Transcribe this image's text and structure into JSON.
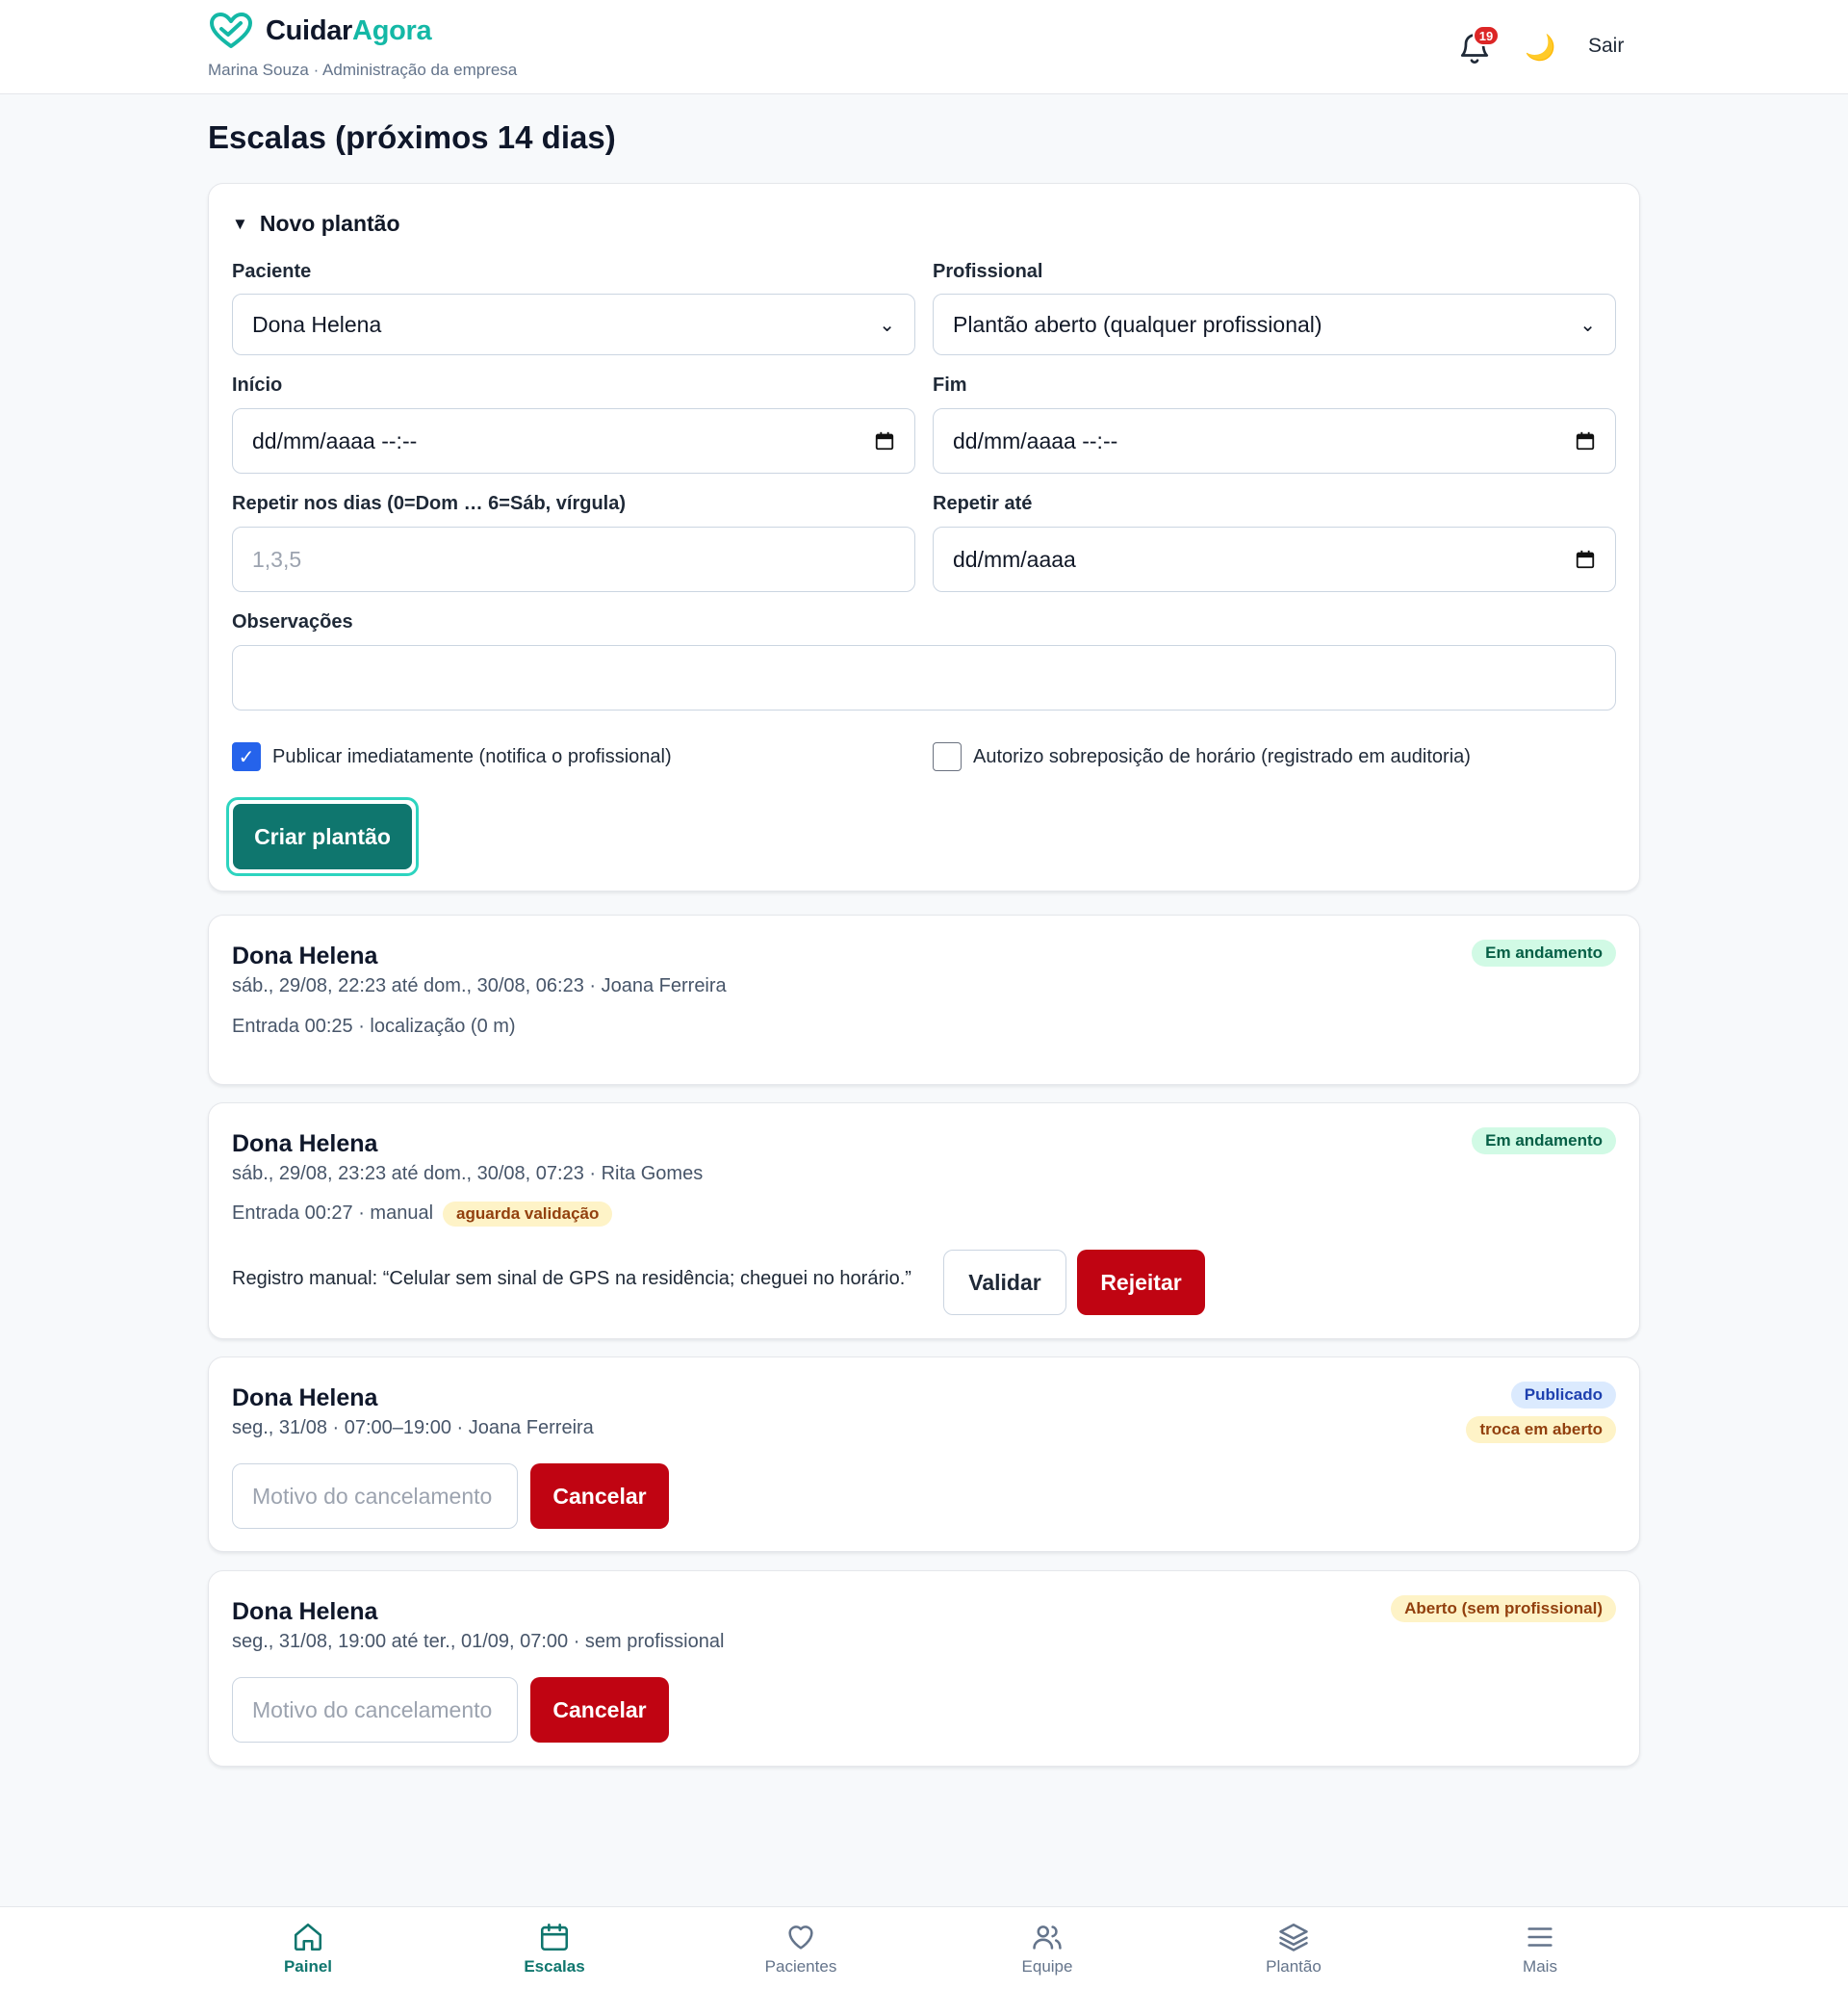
{
  "header": {
    "brand_a": "Cuidar",
    "brand_b": "Agora",
    "subtitle": "Marina Souza · Administração da empresa",
    "notifications": "19",
    "logout": "Sair",
    "theme_icon": "moon-icon"
  },
  "page": {
    "title": "Escalas (próximos 14 dias)"
  },
  "form": {
    "summary": "Novo plantão",
    "patient_label": "Paciente",
    "patient_value": "Dona Helena",
    "professional_label": "Profissional",
    "professional_value": "Plantão aberto (qualquer profissional)",
    "start_label": "Início",
    "start_value": "dd/mm/aaaa --:--",
    "end_label": "Fim",
    "end_value": "dd/mm/aaaa --:--",
    "repeat_days_label": "Repetir nos dias (0=Dom … 6=Sáb, vírgula)",
    "repeat_days_placeholder": "1,3,5",
    "repeat_until_label": "Repetir até",
    "repeat_until_value": "dd/mm/aaaa",
    "notes_label": "Observações",
    "notes_value": "",
    "publish_label": "Publicar imediatamente (notifica o profissional)",
    "publish_checked": true,
    "overlap_label": "Autorizo sobreposição de horário (registrado em auditoria)",
    "overlap_checked": false,
    "submit_label": "Criar plantão"
  },
  "shifts": [
    {
      "patient": "Dona Helena",
      "meta": "sáb., 29/08, 22:23 até dom., 30/08, 06:23 · Joana Ferreira",
      "status": "Em andamento",
      "entry": "Entrada 00:25 · localização (0 m)"
    },
    {
      "patient": "Dona Helena",
      "meta": "sáb., 29/08, 23:23 até dom., 30/08, 07:23 · Rita Gomes",
      "status": "Em andamento",
      "entry": "Entrada 00:27 · manual",
      "entry_badge": "aguarda validação",
      "note": "Registro manual: “Celular sem sinal de GPS na residência; cheguei no horário.”",
      "validate_label": "Validar",
      "reject_label": "Rejeitar"
    },
    {
      "patient": "Dona Helena",
      "meta": "seg., 31/08 · 07:00–19:00 · Joana Ferreira",
      "status": "Publicado",
      "status2": "troca em aberto",
      "reason_placeholder": "Motivo do cancelamento",
      "cancel_label": "Cancelar"
    },
    {
      "patient": "Dona Helena",
      "meta": "seg., 31/08, 19:00 até ter., 01/09, 07:00 · sem profissional",
      "status": "Aberto (sem profissional)",
      "reason_placeholder": "Motivo do cancelamento",
      "cancel_label": "Cancelar"
    }
  ],
  "nav": [
    {
      "label": "Painel",
      "icon": "home-icon",
      "active": true
    },
    {
      "label": "Escalas",
      "icon": "calendar-icon",
      "active": true
    },
    {
      "label": "Pacientes",
      "icon": "heart-icon",
      "active": false
    },
    {
      "label": "Equipe",
      "icon": "users-icon",
      "active": false
    },
    {
      "label": "Plantão",
      "icon": "layers-icon",
      "active": false
    },
    {
      "label": "Mais",
      "icon": "menu-icon",
      "active": false
    }
  ],
  "colors": {
    "accent": "#0f766e",
    "brand": "#14b8a6",
    "danger": "#c00412"
  }
}
